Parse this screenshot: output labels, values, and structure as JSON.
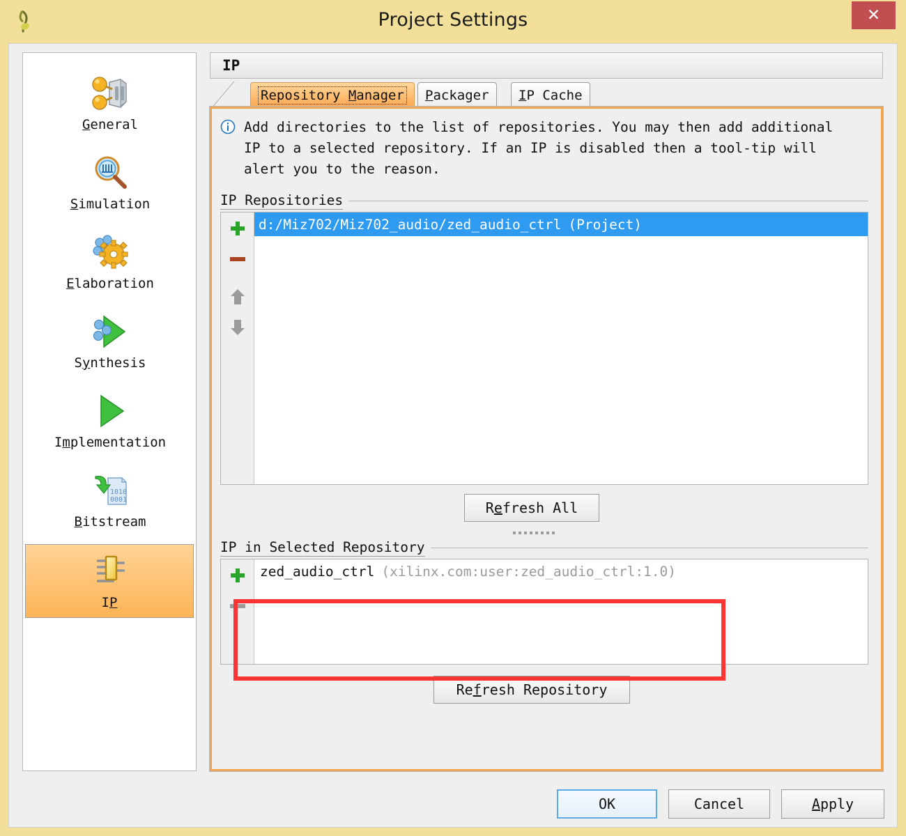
{
  "window": {
    "title": "Project Settings",
    "app_icon": "vivado-logo-icon",
    "close_label": "✕",
    "titlebar_color": "#f2e09a",
    "close_button_color": "#c14f52"
  },
  "sidebar": {
    "items": [
      {
        "label": "General",
        "mnemonic": "G",
        "icon": "general-settings-icon",
        "selected": false
      },
      {
        "label": "Simulation",
        "mnemonic": "S",
        "icon": "simulation-magnifier-icon",
        "selected": false
      },
      {
        "label": "Elaboration",
        "mnemonic": "E",
        "icon": "elaboration-gear-icon",
        "selected": false
      },
      {
        "label": "Synthesis",
        "mnemonic": "y",
        "icon": "synthesis-play-icon",
        "selected": false
      },
      {
        "label": "Implementation",
        "mnemonic": "m",
        "icon": "implementation-play-icon",
        "selected": false
      },
      {
        "label": "Bitstream",
        "mnemonic": "B",
        "icon": "bitstream-file-icon",
        "selected": false
      },
      {
        "label": "IP",
        "mnemonic": "P",
        "icon": "ip-chip-icon",
        "selected": true
      }
    ],
    "selection_color": "#fcb456"
  },
  "panel": {
    "header_title": "IP",
    "border_color": "#f0a44e"
  },
  "tabs": [
    {
      "label": "Repository Manager",
      "mnemonic": "M",
      "active": true
    },
    {
      "label": "Packager",
      "mnemonic": "P",
      "active": false
    },
    {
      "label": "IP Cache",
      "mnemonic": "I",
      "active": false
    }
  ],
  "info": {
    "icon": "info-circle-icon",
    "text": "Add directories to the list of repositories. You may then add additional\nIP to a selected repository. If an IP is disabled then a tool-tip will\nalert you to the reason."
  },
  "ip_repositories": {
    "group_label": "IP Repositories",
    "toolbar": [
      {
        "name": "add-repository-button",
        "icon": "plus-icon",
        "enabled": true
      },
      {
        "name": "remove-repository-button",
        "icon": "minus-icon",
        "enabled": true
      },
      {
        "name": "move-up-button",
        "icon": "arrow-up-icon",
        "enabled": false
      },
      {
        "name": "move-down-button",
        "icon": "arrow-down-icon",
        "enabled": false
      }
    ],
    "rows": [
      {
        "path": "d:/Miz702/Miz702_audio/zed_audio_ctrl",
        "suffix": "(Project)",
        "selected": true
      }
    ],
    "selection_color": "#2e9bf0",
    "refresh_all_label": "Refresh All",
    "refresh_all_mnemonic": "e"
  },
  "ip_in_selected_repository": {
    "group_label": "IP in Selected Repository",
    "toolbar": [
      {
        "name": "add-ip-button",
        "icon": "plus-icon",
        "enabled": true
      },
      {
        "name": "remove-ip-button",
        "icon": "minus-icon",
        "enabled": false
      }
    ],
    "rows": [
      {
        "name": "zed_audio_ctrl",
        "vlnv": "(xilinx.com:user:zed_audio_ctrl:1.0)"
      }
    ],
    "refresh_repository_label": "Refresh Repository",
    "refresh_repository_mnemonic": "f",
    "annotation_color": "#fb3434"
  },
  "footer": {
    "buttons": [
      {
        "label": "OK",
        "mnemonic": "",
        "default": true
      },
      {
        "label": "Cancel",
        "mnemonic": "",
        "default": false
      },
      {
        "label": "Apply",
        "mnemonic": "A",
        "default": false
      }
    ]
  }
}
